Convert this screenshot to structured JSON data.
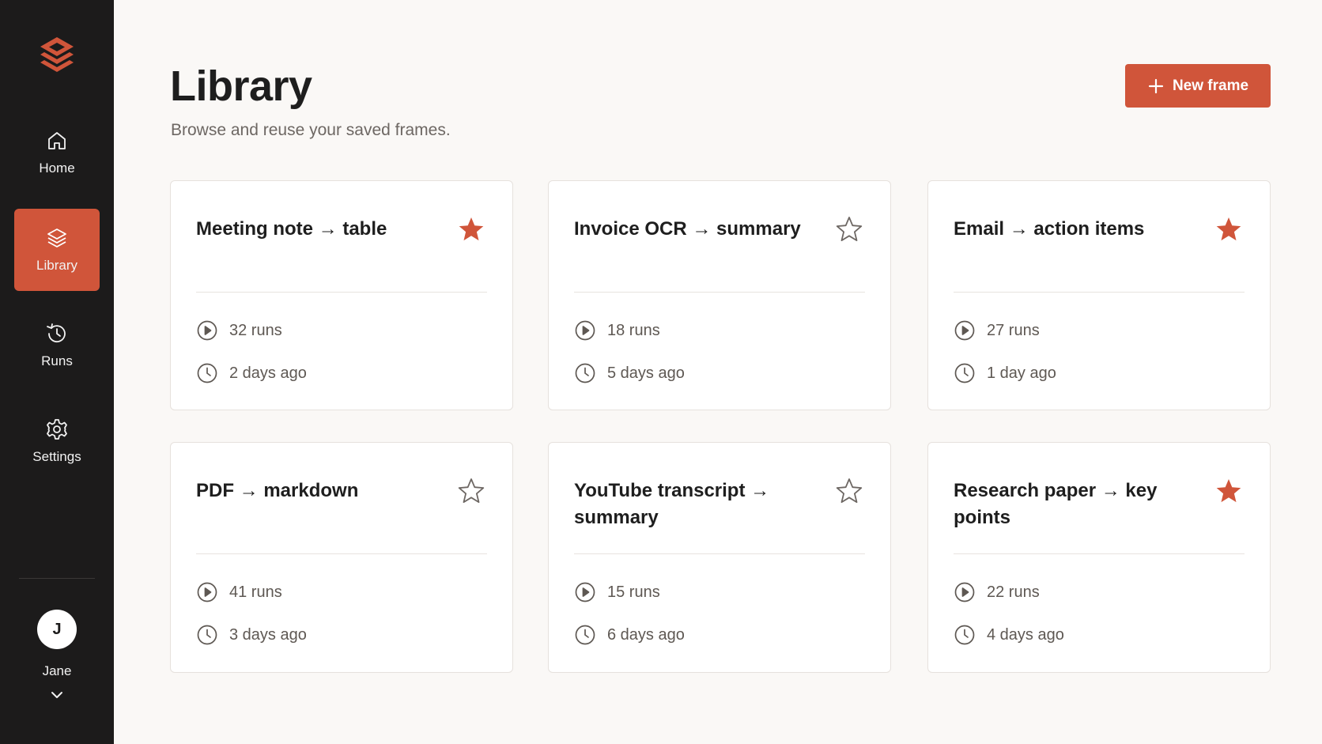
{
  "colors": {
    "accent": "#d0553a",
    "sidebar_bg": "#1c1b1b",
    "page_bg": "#faf8f6"
  },
  "sidebar": {
    "logo_icon": "layers-logo-icon",
    "items": [
      {
        "label": "Home",
        "icon": "home-icon",
        "active": false
      },
      {
        "label": "Library",
        "icon": "layers-icon",
        "active": true
      },
      {
        "label": "Runs",
        "icon": "history-icon",
        "active": false
      },
      {
        "label": "Settings",
        "icon": "gear-icon",
        "active": false
      }
    ],
    "user": {
      "initial": "J",
      "name": "Jane"
    }
  },
  "header": {
    "title": "Library",
    "subtitle": "Browse and reuse your saved frames.",
    "new_button_label": "New frame"
  },
  "cards": [
    {
      "title": "Meeting note → table",
      "starred": true,
      "runs": "32 runs",
      "updated": "2 days ago"
    },
    {
      "title": "Invoice OCR → summary",
      "starred": false,
      "runs": "18 runs",
      "updated": "5 days ago"
    },
    {
      "title": "Email → action items",
      "starred": true,
      "runs": "27 runs",
      "updated": "1 day ago"
    },
    {
      "title": "PDF → markdown",
      "starred": false,
      "runs": "41 runs",
      "updated": "3 days ago"
    },
    {
      "title": "YouTube transcript → summary",
      "starred": false,
      "runs": "15 runs",
      "updated": "6 days ago"
    },
    {
      "title": "Research paper → key points",
      "starred": true,
      "runs": "22 runs",
      "updated": "4 days ago"
    }
  ]
}
